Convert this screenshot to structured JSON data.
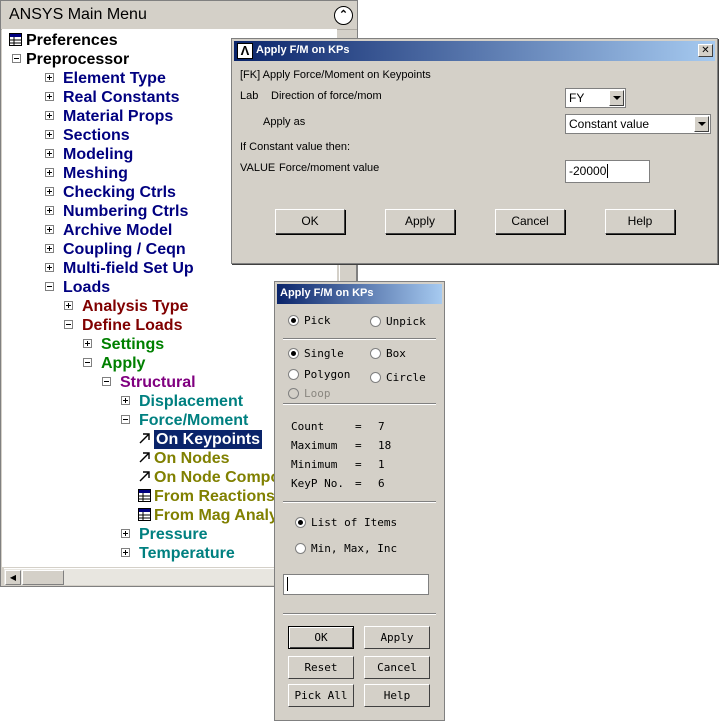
{
  "main_menu": {
    "title": "ANSYS Main Menu",
    "tree": [
      {
        "label": "Preferences",
        "color": "#000000",
        "icon": "table-icon"
      },
      {
        "label": "Preprocessor",
        "color": "#000000",
        "expander": "minus"
      },
      {
        "label": "Element Type",
        "color": "#000080",
        "expander": "plus"
      },
      {
        "label": "Real Constants",
        "color": "#000080",
        "expander": "plus"
      },
      {
        "label": "Material Props",
        "color": "#000080",
        "expander": "plus"
      },
      {
        "label": "Sections",
        "color": "#000080",
        "expander": "plus"
      },
      {
        "label": "Modeling",
        "color": "#000080",
        "expander": "plus"
      },
      {
        "label": "Meshing",
        "color": "#000080",
        "expander": "plus"
      },
      {
        "label": "Checking Ctrls",
        "color": "#000080",
        "expander": "plus"
      },
      {
        "label": "Numbering Ctrls",
        "color": "#000080",
        "expander": "plus"
      },
      {
        "label": "Archive Model",
        "color": "#000080",
        "expander": "plus"
      },
      {
        "label": "Coupling / Ceqn",
        "color": "#000080",
        "expander": "plus"
      },
      {
        "label": "Multi-field Set Up",
        "color": "#000080",
        "expander": "plus"
      },
      {
        "label": "Loads",
        "color": "#000080",
        "expander": "minus"
      },
      {
        "label": "Analysis Type",
        "color": "#800000",
        "expander": "plus"
      },
      {
        "label": "Define Loads",
        "color": "#800000",
        "expander": "minus"
      },
      {
        "label": "Settings",
        "color": "#008000",
        "expander": "plus"
      },
      {
        "label": "Apply",
        "color": "#008000",
        "expander": "minus"
      },
      {
        "label": "Structural",
        "color": "#800080",
        "expander": "minus"
      },
      {
        "label": "Displacement",
        "color": "#008080",
        "expander": "plus"
      },
      {
        "label": "Force/Moment",
        "color": "#008080",
        "expander": "minus"
      },
      {
        "label": "On Keypoints",
        "color": "#808000",
        "icon": "arrow-icon",
        "selected": true
      },
      {
        "label": "On Nodes",
        "color": "#808000",
        "icon": "arrow-icon"
      },
      {
        "label": "On Node Components",
        "color": "#808000",
        "icon": "arrow-icon"
      },
      {
        "label": "From Reactions",
        "color": "#808000",
        "icon": "table-icon"
      },
      {
        "label": "From Mag Analy",
        "color": "#808000",
        "icon": "table-icon"
      },
      {
        "label": "Pressure",
        "color": "#008080",
        "expander": "plus"
      },
      {
        "label": "Temperature",
        "color": "#008080",
        "expander": "plus"
      }
    ]
  },
  "dialog": {
    "title": "Apply F/M on KPs",
    "header": "[FK]  Apply Force/Moment on Keypoints",
    "lab_label": "Lab",
    "direction_label": "Direction of force/mom",
    "direction_value": "FY",
    "apply_as_label": "Apply as",
    "apply_as_value": "Constant value",
    "if_constant_label": "If Constant value then:",
    "value_label": "VALUE",
    "value_desc": "Force/moment value",
    "value_input": "-20000",
    "buttons": {
      "ok": "OK",
      "apply": "Apply",
      "cancel": "Cancel",
      "help": "Help"
    }
  },
  "picker": {
    "title": "Apply F/M on KPs",
    "pick": "Pick",
    "unpick": "Unpick",
    "single": "Single",
    "box": "Box",
    "polygon": "Polygon",
    "circle": "Circle",
    "loop": "Loop",
    "stats": [
      {
        "label": "Count",
        "eq": "=",
        "value": "7"
      },
      {
        "label": "Maximum",
        "eq": "=",
        "value": "18"
      },
      {
        "label": "Minimum",
        "eq": "=",
        "value": "1"
      },
      {
        "label": "KeyP No.",
        "eq": "=",
        "value": "6"
      }
    ],
    "list_of_items": "List of Items",
    "min_max_inc": "Min, Max, Inc",
    "entry_value": "",
    "buttons": {
      "ok": "OK",
      "apply": "Apply",
      "reset": "Reset",
      "cancel": "Cancel",
      "pick_all": "Pick All",
      "help": "Help"
    }
  }
}
